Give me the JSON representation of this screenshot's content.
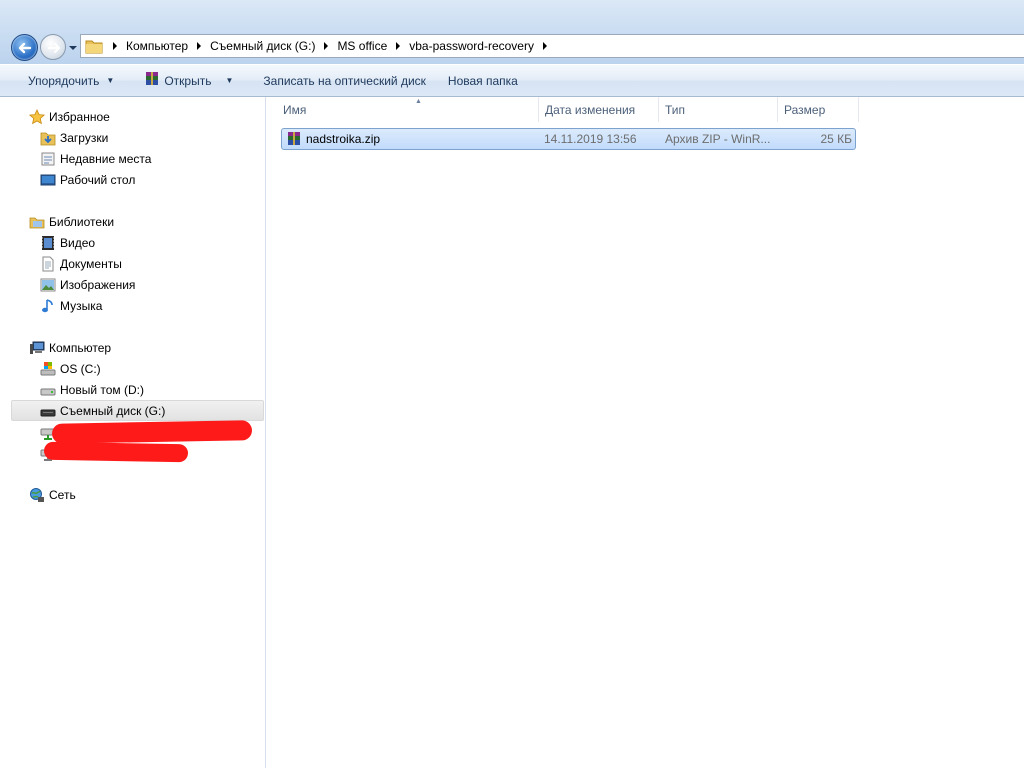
{
  "address_bar": {
    "crumbs": [
      "Компьютер",
      "Съемный диск (G:)",
      "MS office",
      "vba-password-recovery"
    ]
  },
  "toolbar": {
    "organize_label": "Упорядочить",
    "open_label": "Открыть",
    "burn_label": "Записать на оптический диск",
    "new_folder_label": "Новая папка"
  },
  "navigation": {
    "favorites": {
      "label": "Избранное",
      "items": [
        "Загрузки",
        "Недавние места",
        "Рабочий стол"
      ]
    },
    "libraries": {
      "label": "Библиотеки",
      "items": [
        "Видео",
        "Документы",
        "Изображения",
        "Музыка"
      ]
    },
    "computer": {
      "label": "Компьютер",
      "items": [
        "OS (C:)",
        "Новый том (D:)",
        "Съемный диск (G:)"
      ],
      "selected": "Съемный диск (G:)"
    },
    "network": {
      "label": "Сеть"
    }
  },
  "file_list": {
    "columns": [
      "Имя",
      "Дата изменения",
      "Тип",
      "Размер"
    ],
    "rows": [
      {
        "name": "nadstroika.zip",
        "modified": "14.11.2019 13:56",
        "type": "Архив ZIP - WinR...",
        "size": "25 КБ"
      }
    ]
  },
  "colors": {
    "selection_fill": "#c1dbfc",
    "selection_border": "#7da2ce",
    "redaction": "#ff1a1a"
  }
}
